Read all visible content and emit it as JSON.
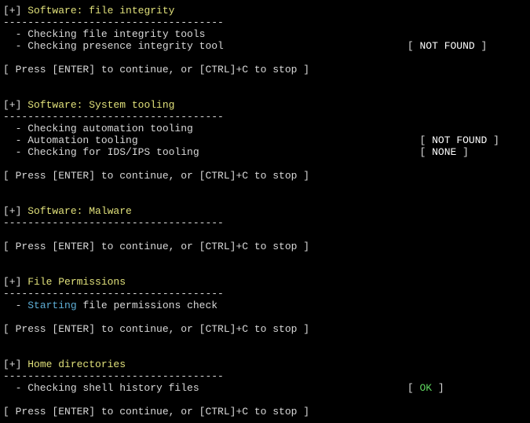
{
  "divider": "------------------------------------",
  "prompt": "[ Press [ENTER] to continue, or [CTRL]+C to stop ]",
  "sections": {
    "file_integrity": {
      "title": "Software: file integrity",
      "check1": "  - Checking file integrity tools",
      "check2": "  - Checking presence integrity tool",
      "status2": "NOT FOUND"
    },
    "system_tooling": {
      "title": "Software: System tooling",
      "check1": "  - Checking automation tooling",
      "check2": "  - Automation tooling",
      "status2": "NOT FOUND",
      "check3": "  - Checking for IDS/IPS tooling",
      "status3": "NONE"
    },
    "malware": {
      "title": "Software: Malware"
    },
    "file_permissions": {
      "title": "File Permissions",
      "starting": "Starting",
      "check1": " file permissions check"
    },
    "home_directories": {
      "title": "Home directories",
      "check1": "  - Checking shell history files",
      "status1": "OK"
    }
  },
  "status_pad_notfound": "                                                                [ ",
  "status_pad_none": "                                                                [ ",
  "status_pad_ok": "                                                                [ ",
  "bracket_close": " ]"
}
